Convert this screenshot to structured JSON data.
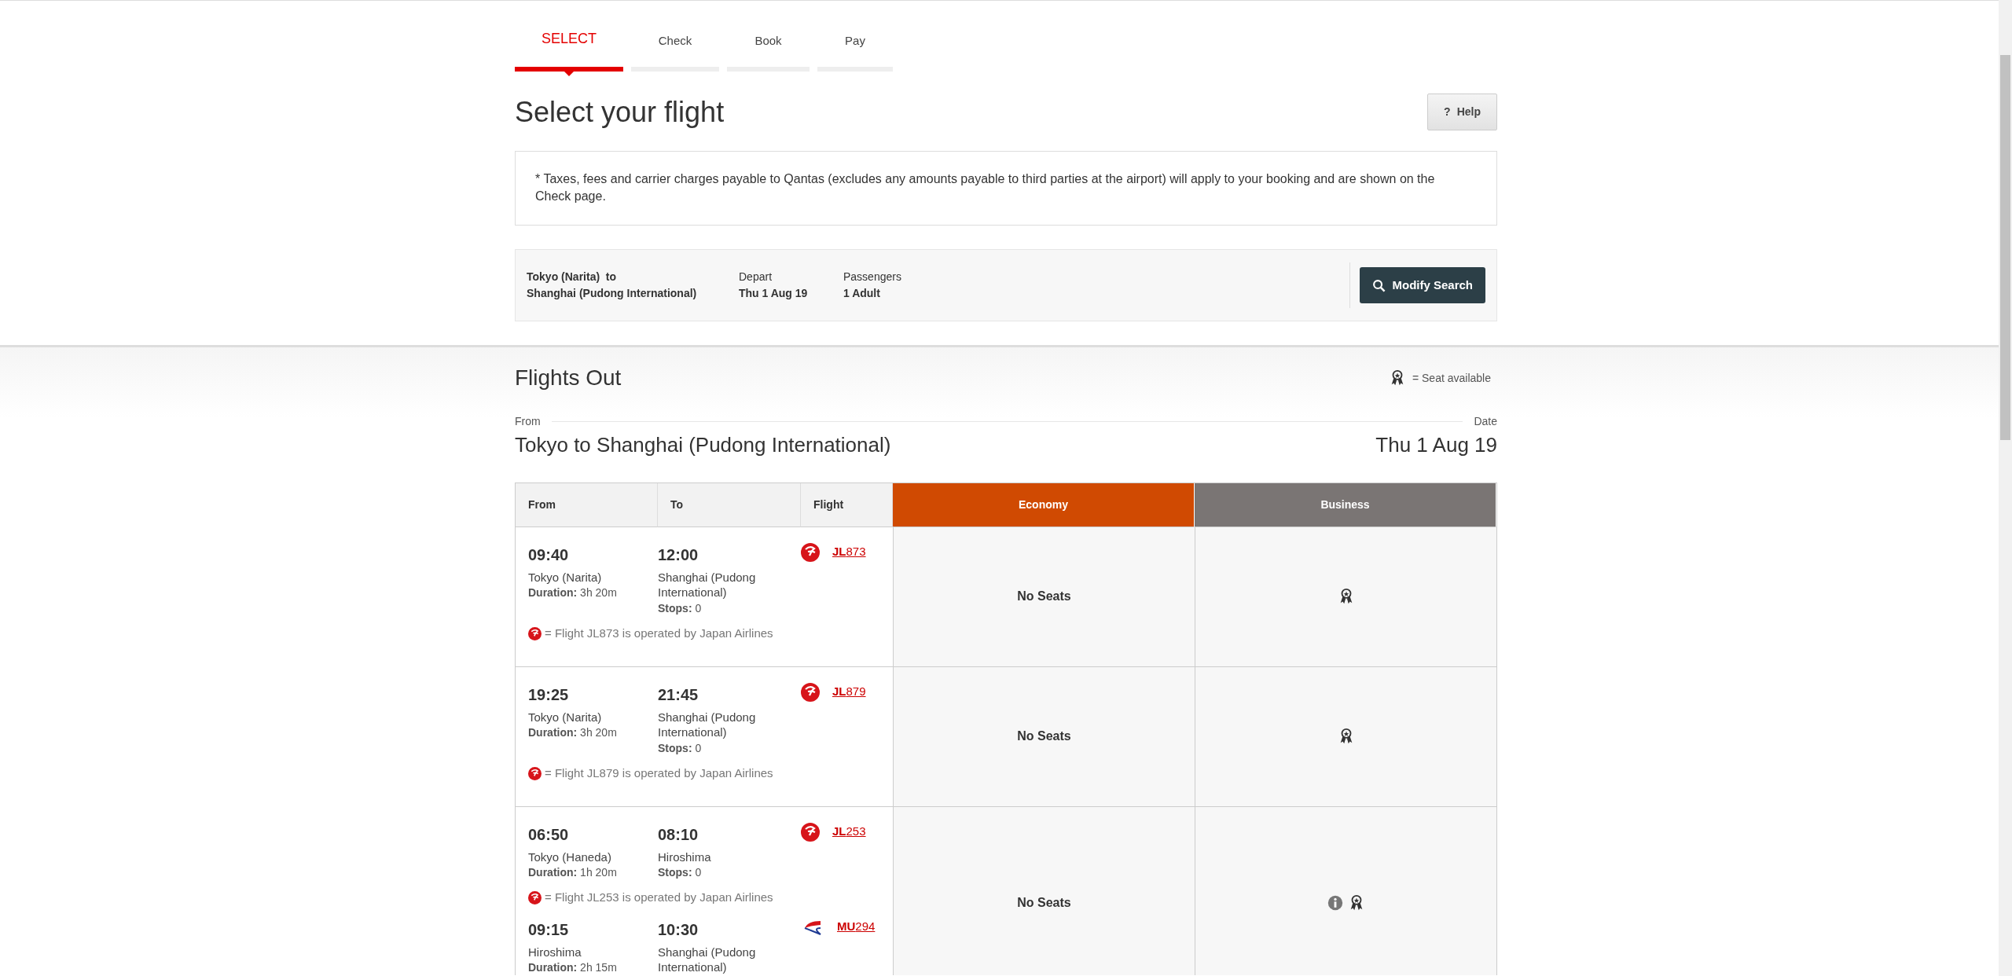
{
  "steps": [
    {
      "label": "SELECT",
      "selected": true
    },
    {
      "label": "Check",
      "selected": false
    },
    {
      "label": "Book",
      "selected": false
    },
    {
      "label": "Pay",
      "selected": false
    }
  ],
  "title": "Select your flight",
  "help_button": {
    "icon": "?",
    "label": "Help"
  },
  "notice": "* Taxes, fees and carrier charges payable to Qantas (excludes any amounts payable to third parties at the airport) will apply to your booking and are shown on the Check page.",
  "search_summary": {
    "route_from": "Tokyo (Narita)  to",
    "route_to": "Shanghai (Pudong International)",
    "depart_label": "Depart",
    "depart_value": "Thu 1 Aug 19",
    "passengers_label": "Passengers",
    "passengers_value": "1 Adult",
    "modify_button": "Modify Search"
  },
  "flights_section": {
    "title": "Flights Out",
    "legend": "= Seat available",
    "from_label": "From",
    "date_label": "Date",
    "route": "Tokyo to Shanghai (Pudong International)",
    "date": "Thu 1 Aug 19"
  },
  "table": {
    "columns": [
      {
        "label": "From",
        "kind": "plain"
      },
      {
        "label": "To",
        "kind": "plain"
      },
      {
        "label": "Flight",
        "kind": "plain"
      },
      {
        "label": "Economy",
        "kind": "fare",
        "color": "#d04a02"
      },
      {
        "label": "Business",
        "kind": "fare",
        "color": "#7a7574"
      }
    ],
    "rows": [
      {
        "segments": [
          {
            "depart_time": "09:40",
            "depart_city": "Tokyo (Narita)",
            "duration": "**Duration:** 3h 20m",
            "arrive_time": "12:00",
            "arrive_city": "Shanghai (Pudong International)",
            "stops": "**Stops:** 0",
            "kind": "jal",
            "flight": "**JL**873",
            "operated_note": "= Flight JL873 is operated by Japan Airlines"
          }
        ],
        "economy": "No Seats",
        "business": {
          "info": false,
          "seat_available": true
        }
      },
      {
        "segments": [
          {
            "depart_time": "19:25",
            "depart_city": "Tokyo (Narita)",
            "duration": "**Duration:** 3h 20m",
            "arrive_time": "21:45",
            "arrive_city": "Shanghai (Pudong International)",
            "stops": "**Stops:** 0",
            "kind": "jal",
            "flight": "**JL**879",
            "operated_note": "= Flight JL879 is operated by Japan Airlines"
          }
        ],
        "economy": "No Seats",
        "business": {
          "info": false,
          "seat_available": true
        }
      },
      {
        "segments": [
          {
            "depart_time": "06:50",
            "depart_city": "Tokyo (Haneda)",
            "duration": "**Duration:** 1h 20m",
            "arrive_time": "08:10",
            "arrive_city": "Hiroshima",
            "stops": "**Stops:** 0",
            "kind": "jal",
            "flight": "**JL**253",
            "operated_note": "= Flight JL253 is operated by Japan Airlines"
          },
          {
            "depart_time": "09:15",
            "depart_city": "Hiroshima",
            "duration": "**Duration:** 2h 15m",
            "arrive_time": "10:30",
            "arrive_city": "Shanghai (Pudong International)",
            "kind": "mu",
            "flight": "**MU**294"
          }
        ],
        "economy": "No Seats",
        "business": {
          "info": true,
          "seat_available": true
        }
      }
    ]
  }
}
